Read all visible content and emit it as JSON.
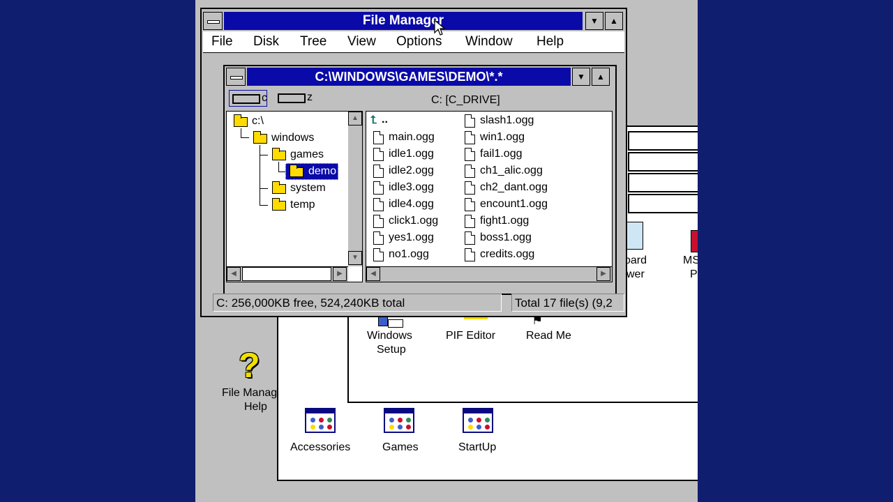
{
  "file_manager": {
    "title": "File Manager",
    "menu": [
      "File",
      "Disk",
      "Tree",
      "View",
      "Options",
      "Window",
      "Help"
    ],
    "child_title": "C:\\WINDOWS\\GAMES\\DEMO\\*.*",
    "drives": [
      "c",
      "z"
    ],
    "drive_label": "C: [C_DRIVE]",
    "tree": [
      {
        "label": "c:\\",
        "level": 0
      },
      {
        "label": "windows",
        "level": 1
      },
      {
        "label": "games",
        "level": 2
      },
      {
        "label": "demo",
        "level": 3,
        "selected": true
      },
      {
        "label": "system",
        "level": 2
      },
      {
        "label": "temp",
        "level": 2
      }
    ],
    "parent_dir": "..",
    "files_col1": [
      "main.ogg",
      "idle1.ogg",
      "idle2.ogg",
      "idle3.ogg",
      "idle4.ogg",
      "click1.ogg",
      "yes1.ogg",
      "no1.ogg"
    ],
    "files_col2": [
      "slash1.ogg",
      "win1.ogg",
      "fail1.ogg",
      "ch1_alic.ogg",
      "ch2_dant.ogg",
      "encount1.ogg",
      "fight1.ogg",
      "boss1.ogg",
      "credits.ogg"
    ],
    "status_free": "C: 256,000KB free,  524,240KB total",
    "status_total": "Total 17 file(s) (9,2"
  },
  "program_manager": {
    "main_icons": [
      {
        "label": "Windows\nSetup",
        "line1": "Windows",
        "line2": "Setup"
      },
      {
        "label": "PIF Editor"
      },
      {
        "label": "Read Me"
      }
    ],
    "partial_icons": [
      {
        "line1": "oard",
        "line2": "wer"
      },
      {
        "line1": "MS",
        "line2": "P"
      }
    ],
    "help_icon": {
      "line1": "File Manag",
      "line2": "Help"
    },
    "groups": [
      "Accessories",
      "Games",
      "StartUp"
    ]
  },
  "colors": {
    "desktop": "#0f1e6e",
    "titlebar": "#0a0aa8",
    "window": "#c0c0c0",
    "folder": "#ffdb00"
  }
}
